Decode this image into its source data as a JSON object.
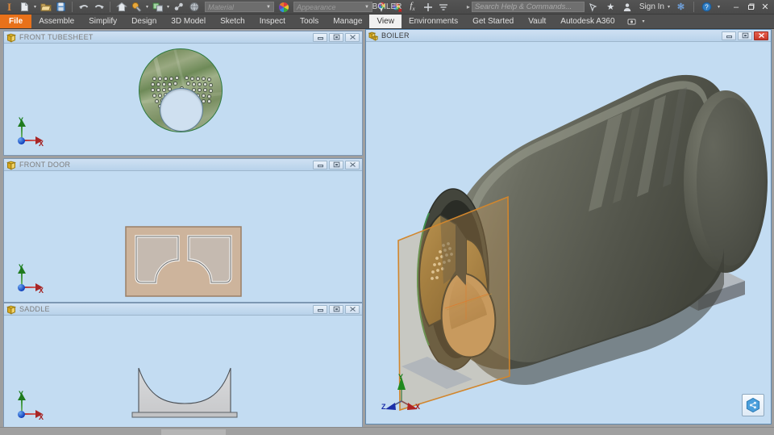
{
  "app": {
    "title": "BOILER",
    "theme_accent": "#e8711a",
    "workspace_bg": "#9e9e9e",
    "viewport_bg": "#c3dcf2"
  },
  "quick_access": {
    "icons": [
      {
        "name": "inventor-logo-icon",
        "glyph": "I"
      },
      {
        "name": "new-file-icon",
        "glyph": "new"
      },
      {
        "name": "open-file-icon",
        "glyph": "open"
      },
      {
        "name": "save-icon",
        "glyph": "save"
      },
      {
        "name": "undo-icon",
        "glyph": "undo"
      },
      {
        "name": "redo-icon",
        "glyph": "redo"
      },
      {
        "name": "home-view-icon",
        "glyph": "home"
      },
      {
        "name": "appearance-paint-icon",
        "glyph": "paint"
      },
      {
        "name": "material-swatch-icon",
        "glyph": "swatch"
      },
      {
        "name": "render-icon",
        "glyph": "render"
      },
      {
        "name": "globe-icon",
        "glyph": "globe"
      }
    ],
    "material_placeholder": "Material",
    "appearance_placeholder": "Appearance",
    "right_icons": [
      {
        "name": "adjust-color-icon",
        "glyph": "adjust"
      },
      {
        "name": "clear-appearance-icon",
        "glyph": "clear"
      },
      {
        "name": "parameters-fx-icon",
        "glyph": "fx"
      },
      {
        "name": "add-icon",
        "glyph": "+"
      },
      {
        "name": "overflow-menu-icon",
        "glyph": "menu"
      }
    ]
  },
  "titlebar": {
    "document_title": "BOILER",
    "search_placeholder": "Search Help & Commands...",
    "signin_label": "Sign In",
    "icons": [
      {
        "name": "expand-title-arrow-icon",
        "glyph": "▸"
      },
      {
        "name": "help-search-flyout-icon",
        "glyph": "flyout"
      },
      {
        "name": "favorites-star-icon",
        "glyph": "★"
      },
      {
        "name": "account-person-icon",
        "glyph": "person"
      },
      {
        "name": "exchange-apps-icon",
        "glyph": "X"
      },
      {
        "name": "help-circle-icon",
        "glyph": "?"
      }
    ],
    "window_controls": [
      {
        "name": "minimize-window-button",
        "glyph": "–"
      },
      {
        "name": "restore-window-button",
        "glyph": "❐"
      },
      {
        "name": "close-window-button",
        "glyph": "✕"
      }
    ]
  },
  "ribbon": {
    "active_tab": "View",
    "tabs": [
      {
        "label": "File",
        "kind": "file"
      },
      {
        "label": "Assemble",
        "kind": "normal"
      },
      {
        "label": "Simplify",
        "kind": "normal"
      },
      {
        "label": "Design",
        "kind": "normal"
      },
      {
        "label": "3D Model",
        "kind": "normal"
      },
      {
        "label": "Sketch",
        "kind": "normal"
      },
      {
        "label": "Inspect",
        "kind": "normal"
      },
      {
        "label": "Tools",
        "kind": "normal"
      },
      {
        "label": "Manage",
        "kind": "normal"
      },
      {
        "label": "View",
        "kind": "active"
      },
      {
        "label": "Environments",
        "kind": "normal"
      },
      {
        "label": "Get Started",
        "kind": "normal"
      },
      {
        "label": "Vault",
        "kind": "normal"
      },
      {
        "label": "Autodesk A360",
        "kind": "normal"
      }
    ],
    "overflow_icon": "ribbon-overflow-icon"
  },
  "windows": [
    {
      "id": "front-tubesheet",
      "title": "FRONT TUBESHEET",
      "doc_icon": "part-document-icon",
      "active": false,
      "controls": [
        {
          "name": "minimize-button",
          "glyph": "–"
        },
        {
          "name": "maximize-button",
          "glyph": "■"
        },
        {
          "name": "close-button",
          "glyph": "✕"
        }
      ]
    },
    {
      "id": "front-door",
      "title": "FRONT DOOR",
      "doc_icon": "part-document-icon",
      "active": false,
      "controls": [
        {
          "name": "minimize-button",
          "glyph": "–"
        },
        {
          "name": "maximize-button",
          "glyph": "■"
        },
        {
          "name": "close-button",
          "glyph": "✕"
        }
      ]
    },
    {
      "id": "saddle",
      "title": "SADDLE",
      "doc_icon": "part-document-icon",
      "active": false,
      "controls": [
        {
          "name": "minimize-button",
          "glyph": "–"
        },
        {
          "name": "maximize-button",
          "glyph": "■"
        },
        {
          "name": "close-button",
          "glyph": "✕"
        }
      ]
    },
    {
      "id": "boiler",
      "title": "BOILER",
      "doc_icon": "assembly-document-icon",
      "active": true,
      "controls": [
        {
          "name": "minimize-button",
          "glyph": "–"
        },
        {
          "name": "maximize-button",
          "glyph": "■"
        },
        {
          "name": "close-button",
          "glyph": "✕"
        }
      ]
    }
  ],
  "axis_triads": {
    "flat": {
      "x_label": "X",
      "y_label": "Y",
      "x_color": "#a32020",
      "y_color": "#167a16",
      "origin_color": "#0a38b8"
    },
    "iso": {
      "x_label": "X",
      "y_label": "Y",
      "z_label": "Z",
      "x_color": "#a32020",
      "y_color": "#167a16",
      "z_color": "#1b2fa8"
    }
  },
  "viewport_overlays": {
    "share_badge": "a360-share-cube-icon"
  },
  "model_colors": {
    "shell": "#5d5f52",
    "shell_highlight": "#8d8f80",
    "interior": "#a07b40",
    "door_frame": "#d08a3c",
    "support_steel": "#9aa0a6",
    "tubesheet_rim": "#2f7a42",
    "door_plate": "#cdb49c"
  }
}
